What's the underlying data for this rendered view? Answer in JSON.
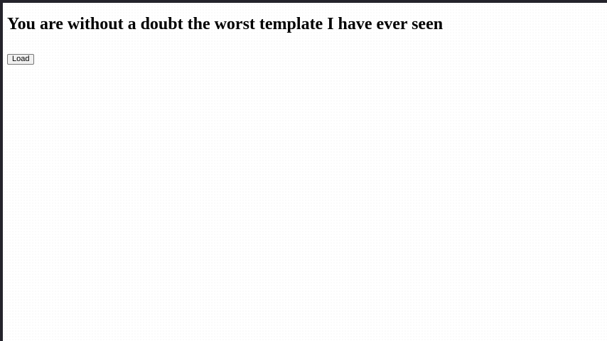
{
  "page": {
    "title": "You are without a doubt the worst template I have ever seen",
    "load_button_label": "Load"
  },
  "colors": {
    "frame": "#24232b",
    "background": "#ffffff",
    "text": "#000000"
  }
}
